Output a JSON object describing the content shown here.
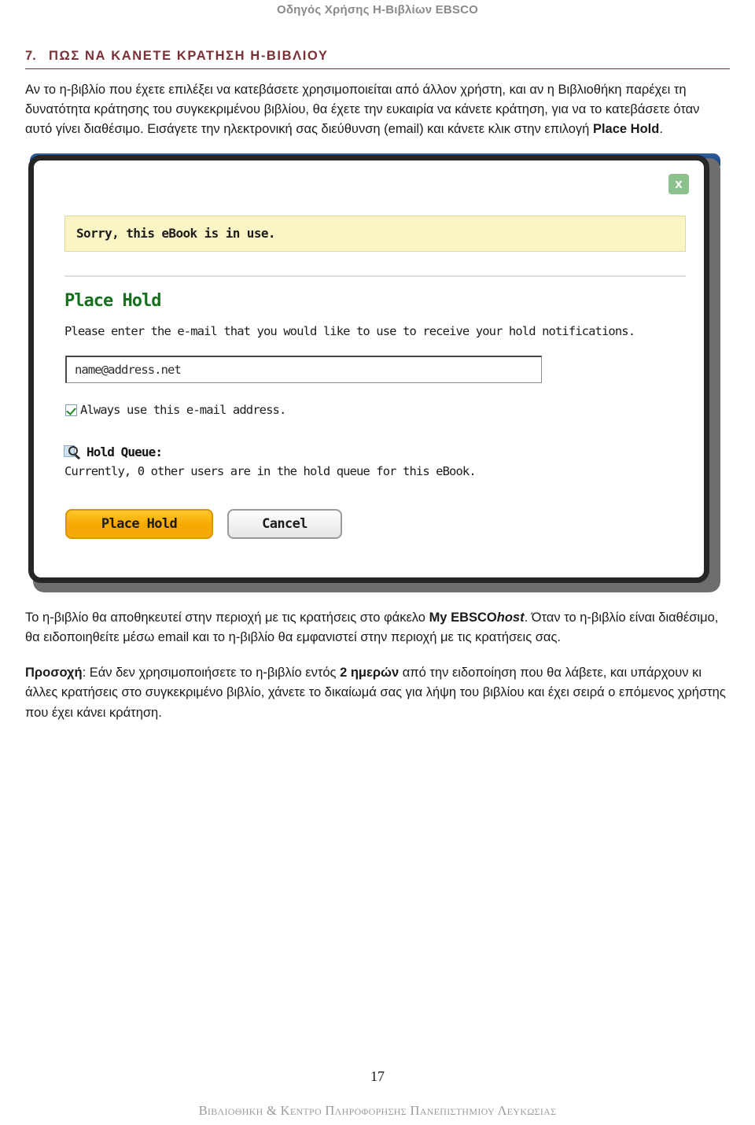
{
  "document": {
    "running_header": "Οδηγός Χρήσης Η-Βιβλίων EBSCO",
    "page_number": "17",
    "footer": "Βιβλιοθηκη & Κεντρο Πληροφορησης Πανεπιστημιου Λευκωσιας"
  },
  "section": {
    "number": "7.",
    "title": "ΠΩΣ ΝΑ ΚΑΝΕΤΕ ΚΡΑΤΗΣΗ Η-ΒΙΒΛΙΟΥ"
  },
  "paragraphs": {
    "intro_part1": "Αν το η-βιβλίο που έχετε επιλέξει να κατεβάσετε χρησιμοποιείται από άλλον χρήστη, και αν η Βιβλιοθήκη παρέχει τη δυνατότητα κράτησης του συγκεκριμένου βιβλίου, θα έχετε την ευκαιρία να κάνετε κράτηση, για να το κατεβάσετε όταν αυτό γίνει διαθέσιμο. Εισάγετε την ηλεκτρονική σας διεύθυνση (email) και κάνετε κλικ στην επιλογή ",
    "intro_bold": "Place Hold",
    "intro_part2": ".",
    "after_part1": "Το η-βιβλίο θα αποθηκευτεί στην περιοχή με τις κρατήσεις στο φάκελο ",
    "after_bold": "My EBSCO",
    "after_bold_italic": "host",
    "after_part2": ". Όταν το η-βιβλίο είναι διαθέσιμο, θα ειδοποιηθείτε μέσω email και το η-βιβλίο θα εμφανιστεί στην περιοχή με τις κρατήσεις σας.",
    "note_label": "Προσοχή",
    "note_part1": ": Εάν δεν χρησιμοποιήσετε το η-βιβλίο εντός ",
    "note_bold": "2 ημερών",
    "note_part2": " από την ειδοποίηση που θα λάβετε, και υπάρχουν κι άλλες κρατήσεις στο συγκεκριμένο βιβλίο, χάνετε το δικαίωμά σας για λήψη του βιβλίου και έχει σειρά ο επόμενος χρήστης που έχει κάνει κράτηση."
  },
  "screenshot": {
    "close_label": "x",
    "alert_message": "Sorry, this eBook is in use.",
    "dialog_title": "Place Hold",
    "instruction": "Please enter the e-mail that you would like to use to receive your hold notifications.",
    "email_value": "name@address.net",
    "checkbox_label": "Always use this e-mail address.",
    "checkbox_checked": true,
    "hold_queue_title": "Hold Queue:",
    "hold_queue_text": "Currently, 0 other users are in the hold queue for this eBook.",
    "primary_button": "Place Hold",
    "secondary_button": "Cancel",
    "colors": {
      "alert_bg": "#fbf4c4",
      "title_green": "#16701e",
      "close_green": "#8cc08c",
      "primary_orange": "#f7a800"
    }
  }
}
